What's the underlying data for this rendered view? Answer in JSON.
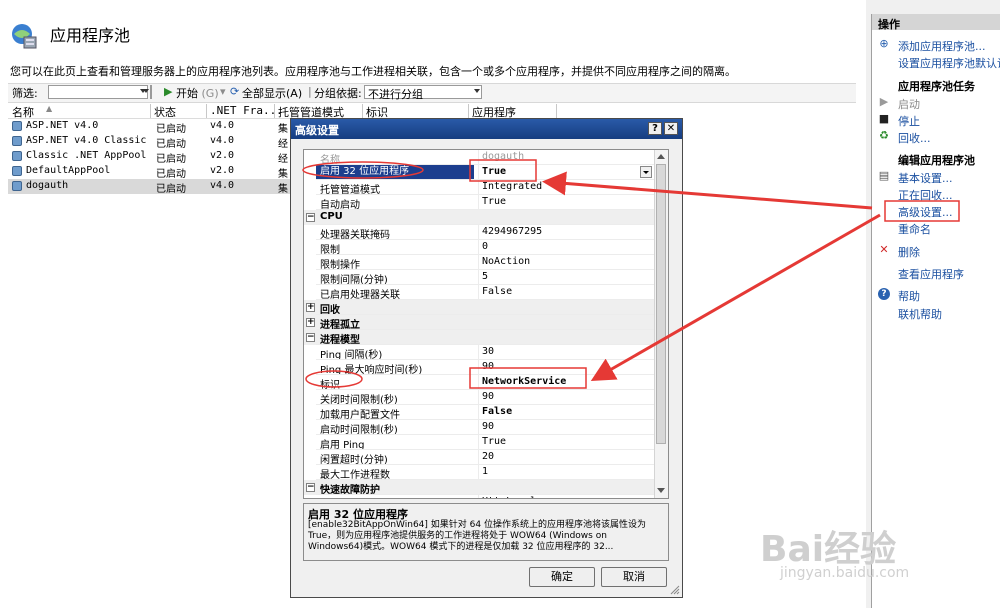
{
  "page": {
    "title": "应用程序池",
    "description": "您可以在此页上查看和管理服务器上的应用程序池列表。应用程序池与工作进程相关联，包含一个或多个应用程序，并提供不同应用程序之间的隔离。"
  },
  "filterbar": {
    "filter_label": "筛选:",
    "start_label": "开始",
    "start_shortcut": "(G)",
    "show_all_label": "全部显示(A)",
    "group_by_label": "分组依据:",
    "group_by_value": "不进行分组"
  },
  "columns": [
    "名称",
    "状态",
    ".NET Fra...",
    "托管管道模式",
    "标识",
    "应用程序"
  ],
  "pools": [
    {
      "name": "ASP.NET v4.0",
      "status": "已启动",
      "net": "v4.0",
      "pipeline": "集"
    },
    {
      "name": "ASP.NET v4.0 Classic",
      "status": "已启动",
      "net": "v4.0",
      "pipeline": "经"
    },
    {
      "name": "Classic .NET AppPool",
      "status": "已启动",
      "net": "v2.0",
      "pipeline": "经"
    },
    {
      "name": "DefaultAppPool",
      "status": "已启动",
      "net": "v2.0",
      "pipeline": "集"
    },
    {
      "name": "dogauth",
      "status": "已启动",
      "net": "v4.0",
      "pipeline": "集"
    }
  ],
  "actions": {
    "header": "操作",
    "add_pool": "添加应用程序池...",
    "set_defaults": "设置应用程序池默认设置...",
    "tasks_header": "应用程序池任务",
    "start": "启动",
    "stop": "停止",
    "recycle": "回收...",
    "edit_header": "编辑应用程序池",
    "basic_settings": "基本设置...",
    "recycling": "正在回收...",
    "advanced_settings": "高级设置...",
    "rename": "重命名",
    "delete": "删除",
    "view_apps": "查看应用程序",
    "help": "帮助",
    "online_help": "联机帮助"
  },
  "dialog": {
    "title": "高级设置",
    "help_btn": "?",
    "close_btn": "✕",
    "rows": [
      {
        "name": "名称",
        "value": "dogauth",
        "kind": "disabled"
      },
      {
        "name": "启用 32 位应用程序",
        "value": "True",
        "kind": "selected"
      },
      {
        "name": "托管管道模式",
        "value": "Integrated",
        "kind": "prop"
      },
      {
        "name": "自动启动",
        "value": "True",
        "kind": "prop"
      },
      {
        "name": "CPU",
        "value": "",
        "kind": "cat",
        "sign": "⊟"
      },
      {
        "name": "处理器关联掩码",
        "value": "4294967295",
        "kind": "prop"
      },
      {
        "name": "限制",
        "value": "0",
        "kind": "prop"
      },
      {
        "name": "限制操作",
        "value": "NoAction",
        "kind": "prop"
      },
      {
        "name": "限制间隔(分钟)",
        "value": "5",
        "kind": "prop"
      },
      {
        "name": "已启用处理器关联",
        "value": "False",
        "kind": "prop"
      },
      {
        "name": "回收",
        "value": "",
        "kind": "cat",
        "sign": "⊞"
      },
      {
        "name": "进程孤立",
        "value": "",
        "kind": "cat",
        "sign": "⊞"
      },
      {
        "name": "进程模型",
        "value": "",
        "kind": "cat",
        "sign": "⊟"
      },
      {
        "name": "Ping 间隔(秒)",
        "value": "30",
        "kind": "prop"
      },
      {
        "name": "Ping 最大响应时间(秒)",
        "value": "90",
        "kind": "prop"
      },
      {
        "name": "标识",
        "value": "NetworkService",
        "kind": "bold"
      },
      {
        "name": "关闭时间限制(秒)",
        "value": "90",
        "kind": "prop"
      },
      {
        "name": "加载用户配置文件",
        "value": "False",
        "kind": "bold"
      },
      {
        "name": "启动时间限制(秒)",
        "value": "90",
        "kind": "prop"
      },
      {
        "name": "启用 Ping",
        "value": "True",
        "kind": "prop"
      },
      {
        "name": "闲置超时(分钟)",
        "value": "20",
        "kind": "prop"
      },
      {
        "name": "最大工作进程数",
        "value": "1",
        "kind": "prop"
      },
      {
        "name": "快速故障防护",
        "value": "",
        "kind": "cat",
        "sign": "⊟"
      },
      {
        "name": "“服务不可用”响应类型",
        "value": "HttpLevel",
        "kind": "prop"
      }
    ],
    "desc_title": "启用 32 位应用程序",
    "desc_text": "[enable32BitAppOnWin64] 如果针对 64 位操作系统上的应用程序池将该属性设为 True，则为应用程序池提供服务的工作进程将处于 WOW64 (Windows on Windows64)模式。WOW64 模式下的进程是仅加载 32 位应用程序的 32...",
    "ok": "确定",
    "cancel": "取消"
  },
  "watermark": {
    "brand": "Bai经验",
    "url": "jingyan.baidu.com"
  },
  "colors": {
    "accent": "#1c3e8e",
    "annotation": "#e53935",
    "link": "#1a4fa0"
  }
}
